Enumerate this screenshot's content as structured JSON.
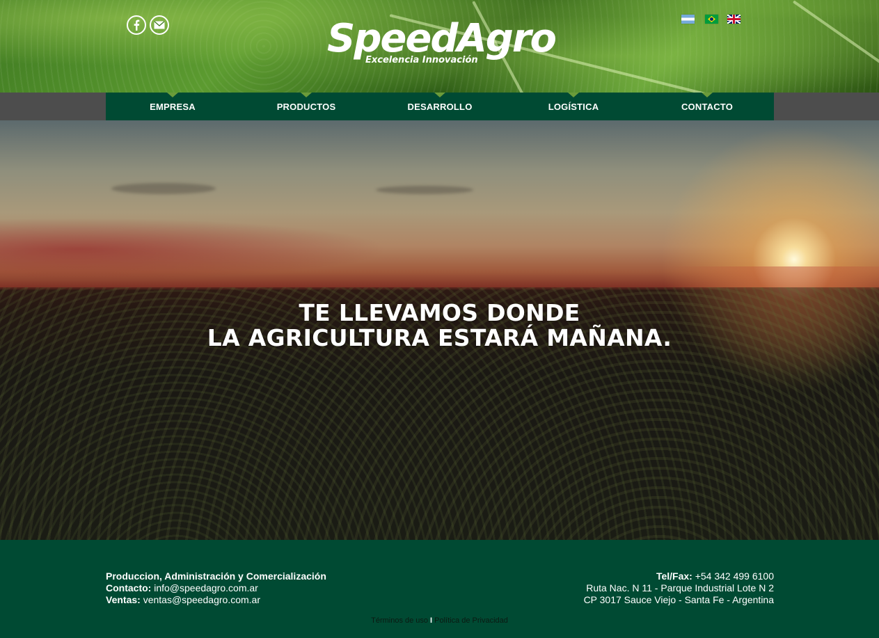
{
  "header": {
    "logo_name": "SpeedAgro",
    "logo_tagline": "Excelencia Innovación",
    "social": [
      "facebook-icon",
      "mail-icon"
    ],
    "languages": [
      "flag-argentina",
      "flag-brazil",
      "flag-uk"
    ]
  },
  "nav": {
    "items": [
      {
        "label": "EMPRESA"
      },
      {
        "label": "PRODUCTOS"
      },
      {
        "label": "DESARROLLO"
      },
      {
        "label": "LOGÍSTICA"
      },
      {
        "label": "CONTACTO"
      }
    ]
  },
  "hero": {
    "line1": "TE LLEVAMOS DONDE",
    "line2": "LA AGRICULTURA ESTARÁ MAÑANA."
  },
  "footer": {
    "left_title": "Produccion, Administración y Comercialización",
    "contacto_label": "Contacto:",
    "contacto_value": "info@speedagro.com.ar",
    "ventas_label": "Ventas:",
    "ventas_value": "ventas@speedagro.com.ar",
    "tel_label": "Tel/Fax:",
    "tel_value": "+54 342 499 6100",
    "address1": "Ruta Nac. N 11 - Parque Industrial Lote N 2",
    "address2": "CP 3017 Sauce Viejo - Santa Fe - Argentina",
    "terms": "Términos de uso",
    "separator": "I",
    "privacy": "Política de Privacidad"
  },
  "colors": {
    "brand_green": "#004a33",
    "nav_gray": "#4d4d4d",
    "notch_green": "#6b9b3a"
  }
}
